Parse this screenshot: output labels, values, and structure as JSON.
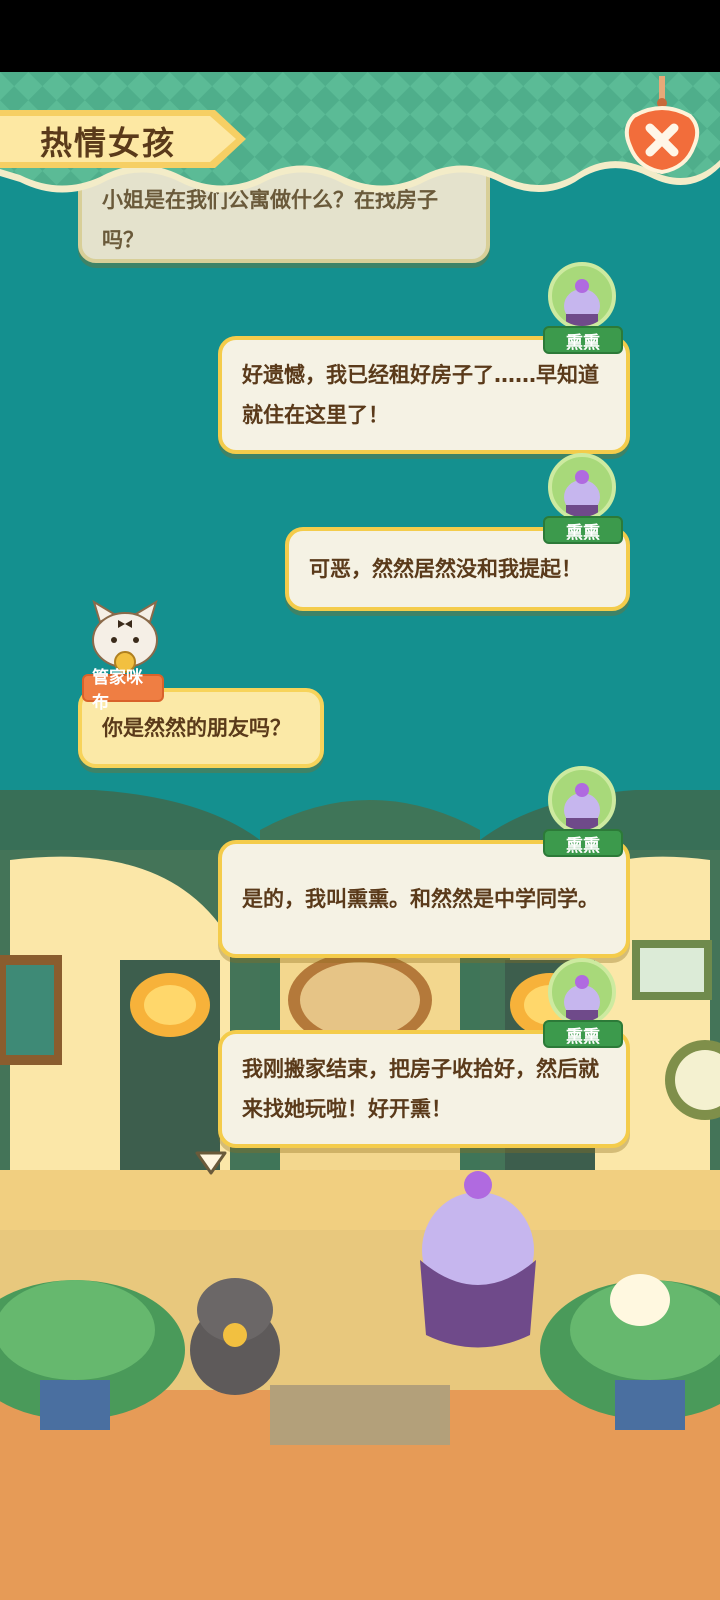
{
  "title": "热情女孩",
  "icons": {
    "close": "close-x-icon",
    "next": "triangle-down-icon"
  },
  "colors": {
    "accent": "#f4cc4b",
    "bubble_bg": "#f5f2e4",
    "text": "#5a3a1a",
    "teal_bg": "#14908f",
    "tag_green": "#3c9a4c",
    "tag_orange": "#ef7e43"
  },
  "dialog": [
    {
      "speaker": "",
      "text": "小姐是在我们公寓做什么？在找房子吗？",
      "side": "left"
    },
    {
      "speaker": "熏熏",
      "text": "好遗憾，我已经租好房子了……早知道就住在这里了！",
      "side": "right"
    },
    {
      "speaker": "熏熏",
      "text": "可恶，然然居然没和我提起！",
      "side": "right"
    },
    {
      "speaker": "管家咪布",
      "text": "你是然然的朋友吗？",
      "side": "left"
    },
    {
      "speaker": "熏熏",
      "text": "是的，我叫熏熏。和然然是中学同学。",
      "side": "right"
    },
    {
      "speaker": "熏熏",
      "text": "我刚搬家结束，把房子收拾好，然后就来找她玩啦！好开熏！",
      "side": "right"
    }
  ]
}
